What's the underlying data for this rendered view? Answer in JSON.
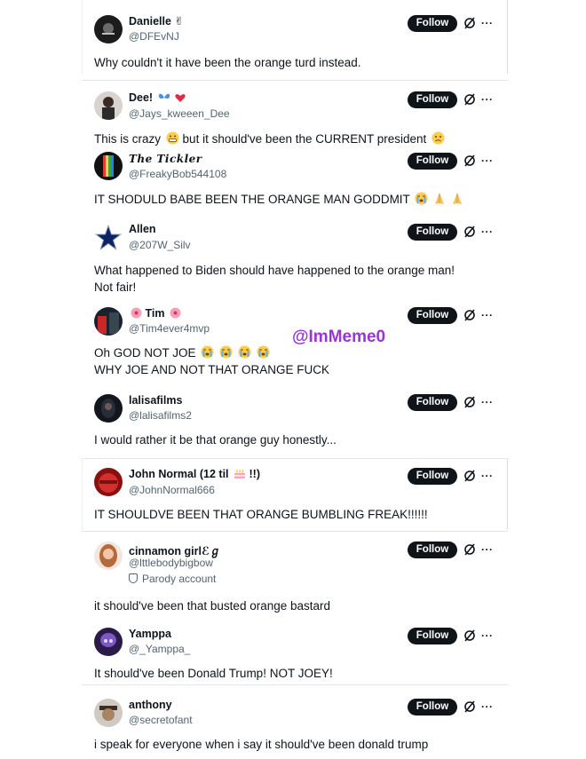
{
  "follow_label": "Follow",
  "more_label": "···",
  "watermark": "@ImMeme0",
  "posts": [
    {
      "name": "Danielle ✌",
      "handle": "@DFEvNJ",
      "text1": "Why couldn't it have been the orange turd instead.",
      "text2": ""
    },
    {
      "name": "Dee!",
      "handle": "@Jays_kweeen_Dee",
      "text1": "This is crazy",
      "text1b": "but it should've been the CURRENT president",
      "text2": ""
    },
    {
      "name": "The Tickler",
      "handle": "@FreakyBob544108",
      "text1": "IT SHODULD BABE BEEN THE ORANGE MAN GODDMIT",
      "text2": ""
    },
    {
      "name": "Allen",
      "handle": "@207W_Silv",
      "text1": "What happened to Biden should have happened to the orange man!",
      "text2": "Not fair!"
    },
    {
      "name": "Tim",
      "handle": "@Tim4ever4mvp",
      "text1": "Oh GOD NOT JOE",
      "text2": "WHY JOE AND NOT THAT ORANGE FUCK"
    },
    {
      "name": "lalisafilms",
      "handle": "@lalisafilms2",
      "text1": "I would rather it be that orange guy honestly...",
      "text2": ""
    },
    {
      "name": "John Normal (12 til",
      "name_suffix": "!!)",
      "handle": "@JohnNormal666",
      "text1": "IT SHOULDVE BEEN THAT ORANGE BUMBLING FREAK!!!!!!",
      "text2": ""
    },
    {
      "name": "cinnamon girl",
      "name_suffix": "ℰℊ",
      "handle": "@lttlebodybigbow",
      "parody": "Parody account",
      "text1": "it should've been that busted orange bastard",
      "text2": ""
    },
    {
      "name": "Yamppa",
      "handle": "@_Yamppa_",
      "text1": "It should've been Donald Trump! NOT JOEY!",
      "text2": ""
    },
    {
      "name": "anthony",
      "handle": "@secretofant",
      "text1": "i speak for everyone when i say it should've been donald trump",
      "text2": ""
    }
  ],
  "icons": {
    "grok": "grok-slash-icon",
    "butterfly": "butterfly-emoji",
    "heart": "red-heart-emoji",
    "crying": "loudly-crying-emoji",
    "praying": "folded-hands-emoji",
    "cake": "birthday-cake-emoji",
    "flower": "hibiscus-emoji",
    "parody": "parody-mask-icon"
  },
  "colors": {
    "follow_bg": "#0f1419",
    "handle": "#536471",
    "watermark": "#9b34d6"
  }
}
